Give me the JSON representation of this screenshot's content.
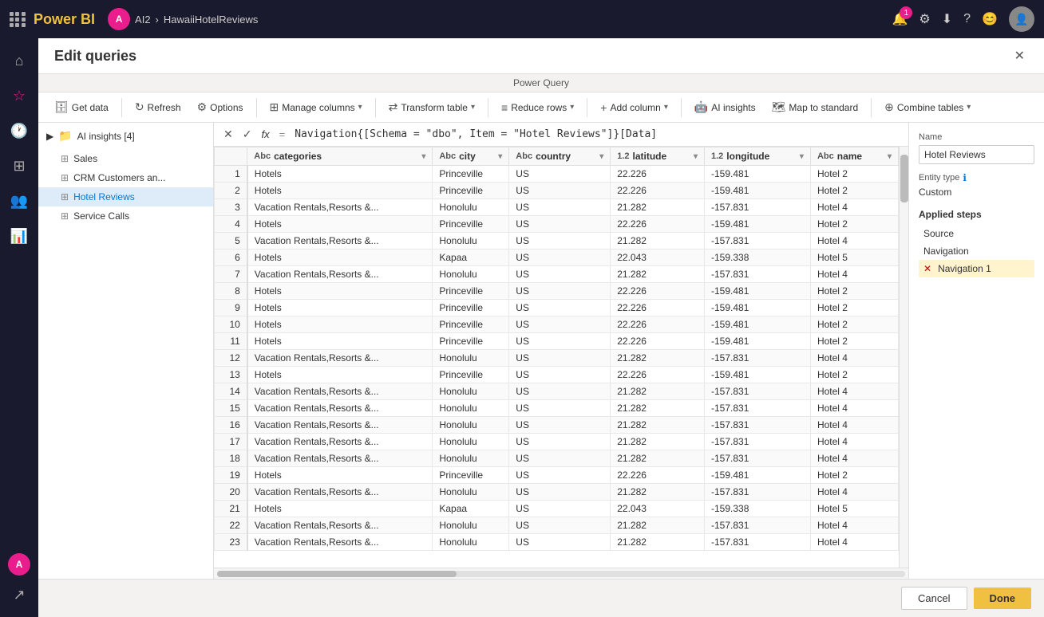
{
  "topbar": {
    "app_name": "Power BI",
    "user_initial": "A",
    "workspace": "AI2",
    "separator": "›",
    "project": "HawaiiHotelReviews",
    "notification_count": "1"
  },
  "dialog": {
    "title": "Edit queries",
    "pq_label": "Power Query",
    "close_icon": "✕"
  },
  "toolbar": {
    "get_data": "Get data",
    "refresh": "Refresh",
    "options": "Options",
    "manage_columns": "Manage columns",
    "transform_table": "Transform table",
    "reduce_rows": "Reduce rows",
    "add_column": "Add column",
    "ai_insights": "AI insights",
    "map_to_standard": "Map to standard",
    "combine_tables": "Combine tables"
  },
  "queries": {
    "group_label": "AI insights [4]",
    "items": [
      {
        "label": "Sales",
        "icon": "table",
        "active": false
      },
      {
        "label": "CRM Customers an...",
        "icon": "table",
        "active": false
      },
      {
        "label": "Hotel Reviews",
        "icon": "table",
        "active": true
      },
      {
        "label": "Service Calls",
        "icon": "table",
        "active": false
      }
    ]
  },
  "formula": {
    "cancel": "✕",
    "confirm": "✓",
    "fx_label": "fx",
    "equals": "=",
    "expression": "Navigation{[Schema = \"dbo\", Item = \"Hotel Reviews\"]}[Data]"
  },
  "table": {
    "columns": [
      {
        "name": "categories",
        "type": "Abc"
      },
      {
        "name": "city",
        "type": "Abc"
      },
      {
        "name": "country",
        "type": "Abc"
      },
      {
        "name": "latitude",
        "type": "1.2"
      },
      {
        "name": "longitude",
        "type": "1.2"
      },
      {
        "name": "name",
        "type": "Abc"
      }
    ],
    "rows": [
      [
        1,
        "Hotels",
        "Princeville",
        "US",
        "22.226",
        "-159.481",
        "Hotel 2"
      ],
      [
        2,
        "Hotels",
        "Princeville",
        "US",
        "22.226",
        "-159.481",
        "Hotel 2"
      ],
      [
        3,
        "Vacation Rentals,Resorts &...",
        "Honolulu",
        "US",
        "21.282",
        "-157.831",
        "Hotel 4"
      ],
      [
        4,
        "Hotels",
        "Princeville",
        "US",
        "22.226",
        "-159.481",
        "Hotel 2"
      ],
      [
        5,
        "Vacation Rentals,Resorts &...",
        "Honolulu",
        "US",
        "21.282",
        "-157.831",
        "Hotel 4"
      ],
      [
        6,
        "Hotels",
        "Kapaa",
        "US",
        "22.043",
        "-159.338",
        "Hotel 5"
      ],
      [
        7,
        "Vacation Rentals,Resorts &...",
        "Honolulu",
        "US",
        "21.282",
        "-157.831",
        "Hotel 4"
      ],
      [
        8,
        "Hotels",
        "Princeville",
        "US",
        "22.226",
        "-159.481",
        "Hotel 2"
      ],
      [
        9,
        "Hotels",
        "Princeville",
        "US",
        "22.226",
        "-159.481",
        "Hotel 2"
      ],
      [
        10,
        "Hotels",
        "Princeville",
        "US",
        "22.226",
        "-159.481",
        "Hotel 2"
      ],
      [
        11,
        "Hotels",
        "Princeville",
        "US",
        "22.226",
        "-159.481",
        "Hotel 2"
      ],
      [
        12,
        "Vacation Rentals,Resorts &...",
        "Honolulu",
        "US",
        "21.282",
        "-157.831",
        "Hotel 4"
      ],
      [
        13,
        "Hotels",
        "Princeville",
        "US",
        "22.226",
        "-159.481",
        "Hotel 2"
      ],
      [
        14,
        "Vacation Rentals,Resorts &...",
        "Honolulu",
        "US",
        "21.282",
        "-157.831",
        "Hotel 4"
      ],
      [
        15,
        "Vacation Rentals,Resorts &...",
        "Honolulu",
        "US",
        "21.282",
        "-157.831",
        "Hotel 4"
      ],
      [
        16,
        "Vacation Rentals,Resorts &...",
        "Honolulu",
        "US",
        "21.282",
        "-157.831",
        "Hotel 4"
      ],
      [
        17,
        "Vacation Rentals,Resorts &...",
        "Honolulu",
        "US",
        "21.282",
        "-157.831",
        "Hotel 4"
      ],
      [
        18,
        "Vacation Rentals,Resorts &...",
        "Honolulu",
        "US",
        "21.282",
        "-157.831",
        "Hotel 4"
      ],
      [
        19,
        "Hotels",
        "Princeville",
        "US",
        "22.226",
        "-159.481",
        "Hotel 2"
      ],
      [
        20,
        "Vacation Rentals,Resorts &...",
        "Honolulu",
        "US",
        "21.282",
        "-157.831",
        "Hotel 4"
      ],
      [
        21,
        "Hotels",
        "Kapaa",
        "US",
        "22.043",
        "-159.338",
        "Hotel 5"
      ],
      [
        22,
        "Vacation Rentals,Resorts &...",
        "Honolulu",
        "US",
        "21.282",
        "-157.831",
        "Hotel 4"
      ],
      [
        23,
        "Vacation Rentals,Resorts &...",
        "Honolulu",
        "US",
        "21.282",
        "-157.831",
        "Hotel 4"
      ]
    ]
  },
  "properties": {
    "name_label": "Name",
    "name_value": "Hotel Reviews",
    "entity_type_label": "Entity type",
    "entity_type_value": "Custom",
    "applied_steps_label": "Applied steps",
    "steps": [
      {
        "label": "Source",
        "active": false,
        "deletable": false
      },
      {
        "label": "Navigation",
        "active": false,
        "deletable": false
      },
      {
        "label": "Navigation 1",
        "active": true,
        "deletable": true
      }
    ]
  },
  "footer": {
    "cancel_label": "Cancel",
    "done_label": "Done"
  }
}
